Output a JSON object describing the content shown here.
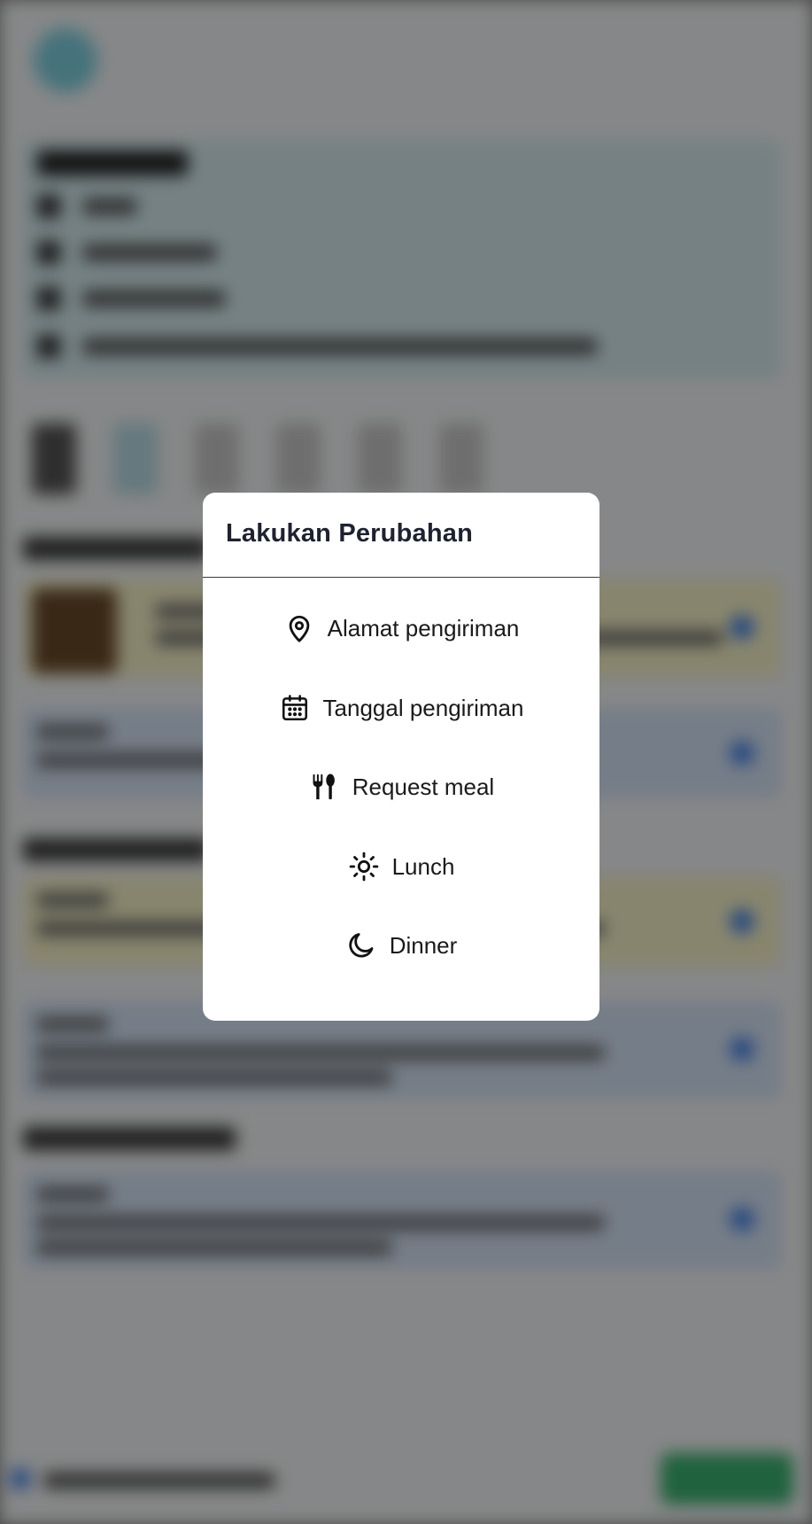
{
  "modal": {
    "title": "Lakukan Perubahan",
    "items": [
      {
        "icon": "map-pin-icon",
        "label": "Alamat pengiriman"
      },
      {
        "icon": "calendar-icon",
        "label": "Tanggal pengiriman"
      },
      {
        "icon": "fork-spoon-icon",
        "label": "Request meal"
      },
      {
        "icon": "sun-icon",
        "label": "Lunch"
      },
      {
        "icon": "moon-icon",
        "label": "Dinner"
      }
    ]
  },
  "colors": {
    "overlay": "#000000",
    "modal_background": "#ffffff",
    "title_text": "#1e2230",
    "item_text": "#1a1a1a",
    "accent_blue": "#4a86e8",
    "accent_green": "#3cb371"
  }
}
